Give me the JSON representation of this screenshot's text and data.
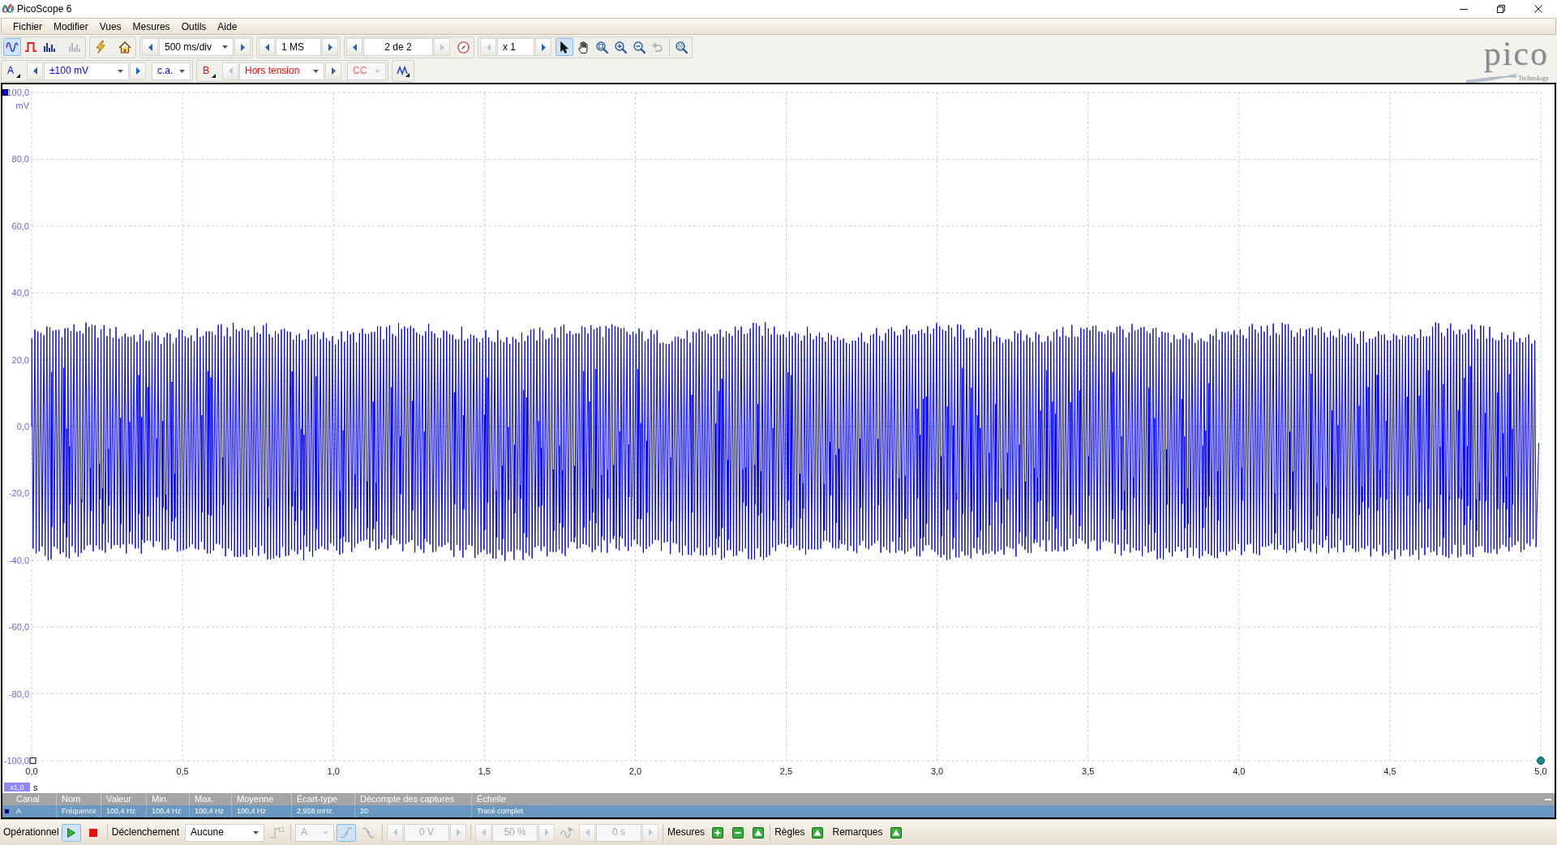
{
  "window": {
    "title": "PicoScope 6"
  },
  "menu": [
    {
      "label": "Fichier"
    },
    {
      "label": "Modifier"
    },
    {
      "label": "Vues"
    },
    {
      "label": "Mesures"
    },
    {
      "label": "Outils"
    },
    {
      "label": "Aide"
    }
  ],
  "toolbar": {
    "modes": [
      {
        "kind": "scope",
        "selected": true,
        "disabled": false
      },
      {
        "kind": "persistence",
        "selected": false,
        "disabled": false
      },
      {
        "kind": "spectrum",
        "selected": false,
        "disabled": false
      },
      {
        "kind": "spectrum",
        "selected": false,
        "disabled": true
      }
    ],
    "tools": [
      {
        "kind": "auto_setup"
      },
      {
        "kind": "home"
      }
    ],
    "timebase": {
      "value": "500 ms/div"
    },
    "samples": {
      "value": "1 MS"
    },
    "buffer": {
      "value": "2 de 2",
      "next_disabled": true
    },
    "zoom": {
      "value": "x 1",
      "prev_disabled": true
    },
    "view_tools": [
      {
        "kind": "pointer",
        "selected": true,
        "disabled": false
      },
      {
        "kind": "hand",
        "selected": false,
        "disabled": false
      },
      {
        "kind": "zoom_fit",
        "selected": false,
        "disabled": false
      },
      {
        "kind": "zoom_in",
        "selected": false,
        "disabled": false
      },
      {
        "kind": "zoom_out",
        "selected": false,
        "disabled": false
      },
      {
        "kind": "undo",
        "selected": false,
        "disabled": true
      },
      {
        "kind": "zoom_overview",
        "selected": false,
        "disabled": false
      }
    ]
  },
  "channels": [
    {
      "name": "A",
      "color": "#0000ff",
      "range": "±100 mV",
      "coupling": "c.a.",
      "enabled": true
    },
    {
      "name": "B",
      "color": "#ff0000",
      "range": "Hors tension",
      "coupling": "CC",
      "enabled": false
    }
  ],
  "logo": {
    "wordmark": "pico",
    "tagline": "Technology"
  },
  "plot": {
    "y_unit": "mV",
    "y_ticks": [
      "100,0",
      "80,0",
      "60,0",
      "40,0",
      "20,0",
      "0,0",
      "-20,0",
      "-40,0",
      "-60,0",
      "-80,0",
      "-100,0"
    ],
    "x_ticks": [
      "0,0",
      "0,5",
      "1,0",
      "1,5",
      "2,0",
      "2,5",
      "3,0",
      "3,5",
      "4,0",
      "4,5",
      "5,0"
    ],
    "x_unit": "s",
    "scale_badge": "x1,0"
  },
  "measurements": {
    "columns": [
      "Canal",
      "Nom",
      "Valeur",
      "Min.",
      "Max.",
      "Moyenne",
      "Écart-type",
      "Décompte des captures",
      "Échelle"
    ],
    "rows": [
      {
        "selected": true,
        "color": "#000080",
        "cells": [
          "A",
          "Fréquence",
          "100,4 Hz",
          "100,4 Hz",
          "100,4 Hz",
          "100,4 Hz",
          "2,958 mHz",
          "20",
          "Tracé complet"
        ]
      }
    ]
  },
  "status_bar": {
    "state": "Opérationnel",
    "running": true,
    "trigger": {
      "label": "Déclenchement",
      "mode": "Aucune",
      "active": false,
      "source": "A",
      "edges": [
        {
          "kind": "rising",
          "selected": true
        },
        {
          "kind": "falling",
          "selected": false
        }
      ],
      "level": "0 V",
      "pretrigger": "50 %",
      "delay": "0 s"
    },
    "panels": [
      {
        "label": "Mesures",
        "actions": [
          {
            "kind": "add"
          },
          {
            "kind": "remove"
          },
          {
            "kind": "edit"
          }
        ]
      },
      {
        "label": "Règles",
        "actions": [
          {
            "kind": "edit"
          }
        ]
      },
      {
        "label": "Remarques",
        "actions": [
          {
            "kind": "edit"
          }
        ]
      }
    ]
  }
}
